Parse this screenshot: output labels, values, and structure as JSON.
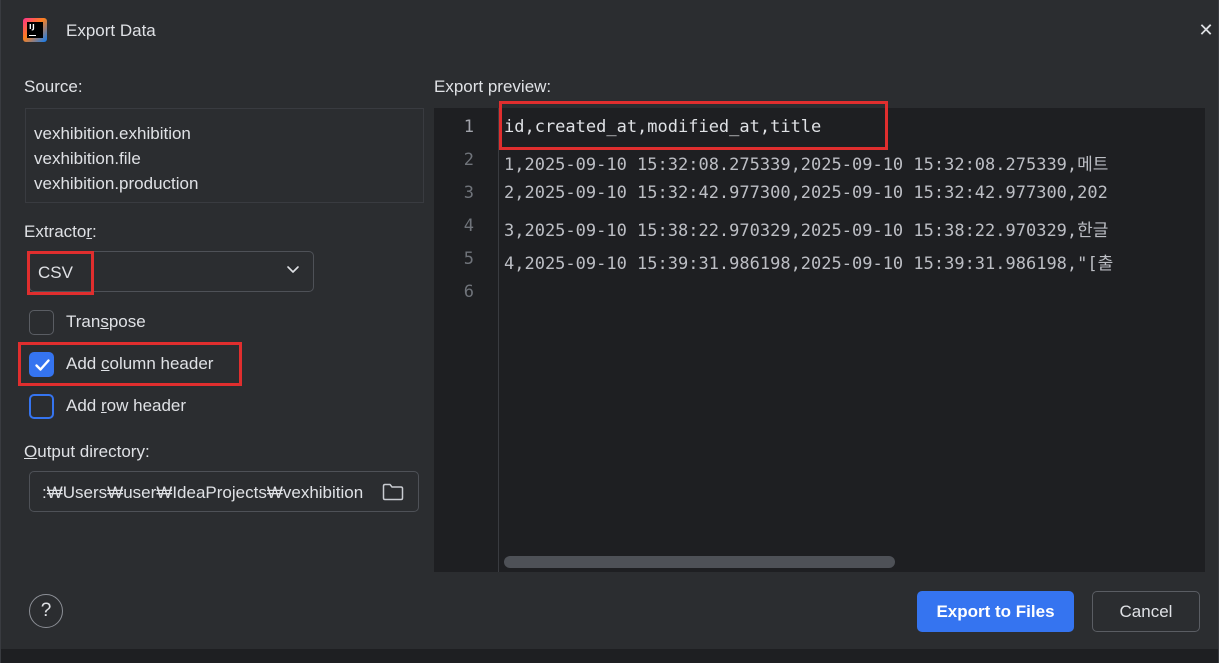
{
  "window": {
    "title": "Export Data"
  },
  "source": {
    "label": "Source:",
    "items": [
      "vexhibition.exhibition",
      "vexhibition.file",
      "vexhibition.production"
    ]
  },
  "extractor": {
    "label_pre": "Extracto",
    "label_mnemonic": "r",
    "label_post": ":",
    "value": "CSV"
  },
  "options": {
    "transpose": {
      "pre": "Tran",
      "mnemonic": "s",
      "post": "pose",
      "checked": false
    },
    "add_column_header": {
      "pre": "Add ",
      "mnemonic": "c",
      "post": "olumn header",
      "checked": true
    },
    "add_row_header": {
      "pre": "Add ",
      "mnemonic": "r",
      "post": "ow header",
      "checked": false
    }
  },
  "output": {
    "label_mnemonic": "O",
    "label_rest": "utput directory:",
    "value": ":₩Users₩user₩IdeaProjects₩vexhibition"
  },
  "preview": {
    "label": "Export preview:",
    "line_numbers": [
      "1",
      "2",
      "3",
      "4",
      "5",
      "6"
    ],
    "lines": [
      "id,created_at,modified_at,title",
      "1,2025-09-10 15:32:08.275339,2025-09-10 15:32:08.275339,메트",
      "2,2025-09-10 15:32:42.977300,2025-09-10 15:32:42.977300,202",
      "3,2025-09-10 15:38:22.970329,2025-09-10 15:38:22.970329,한글",
      "4,2025-09-10 15:39:31.986198,2025-09-10 15:39:31.986198,\"[출",
      ""
    ]
  },
  "buttons": {
    "help": "?",
    "export": "Export to Files",
    "cancel": "Cancel"
  },
  "colors": {
    "accent": "#3574f0",
    "highlight": "#e02e2e",
    "background": "#2b2d30",
    "editor": "#1e1f22"
  }
}
